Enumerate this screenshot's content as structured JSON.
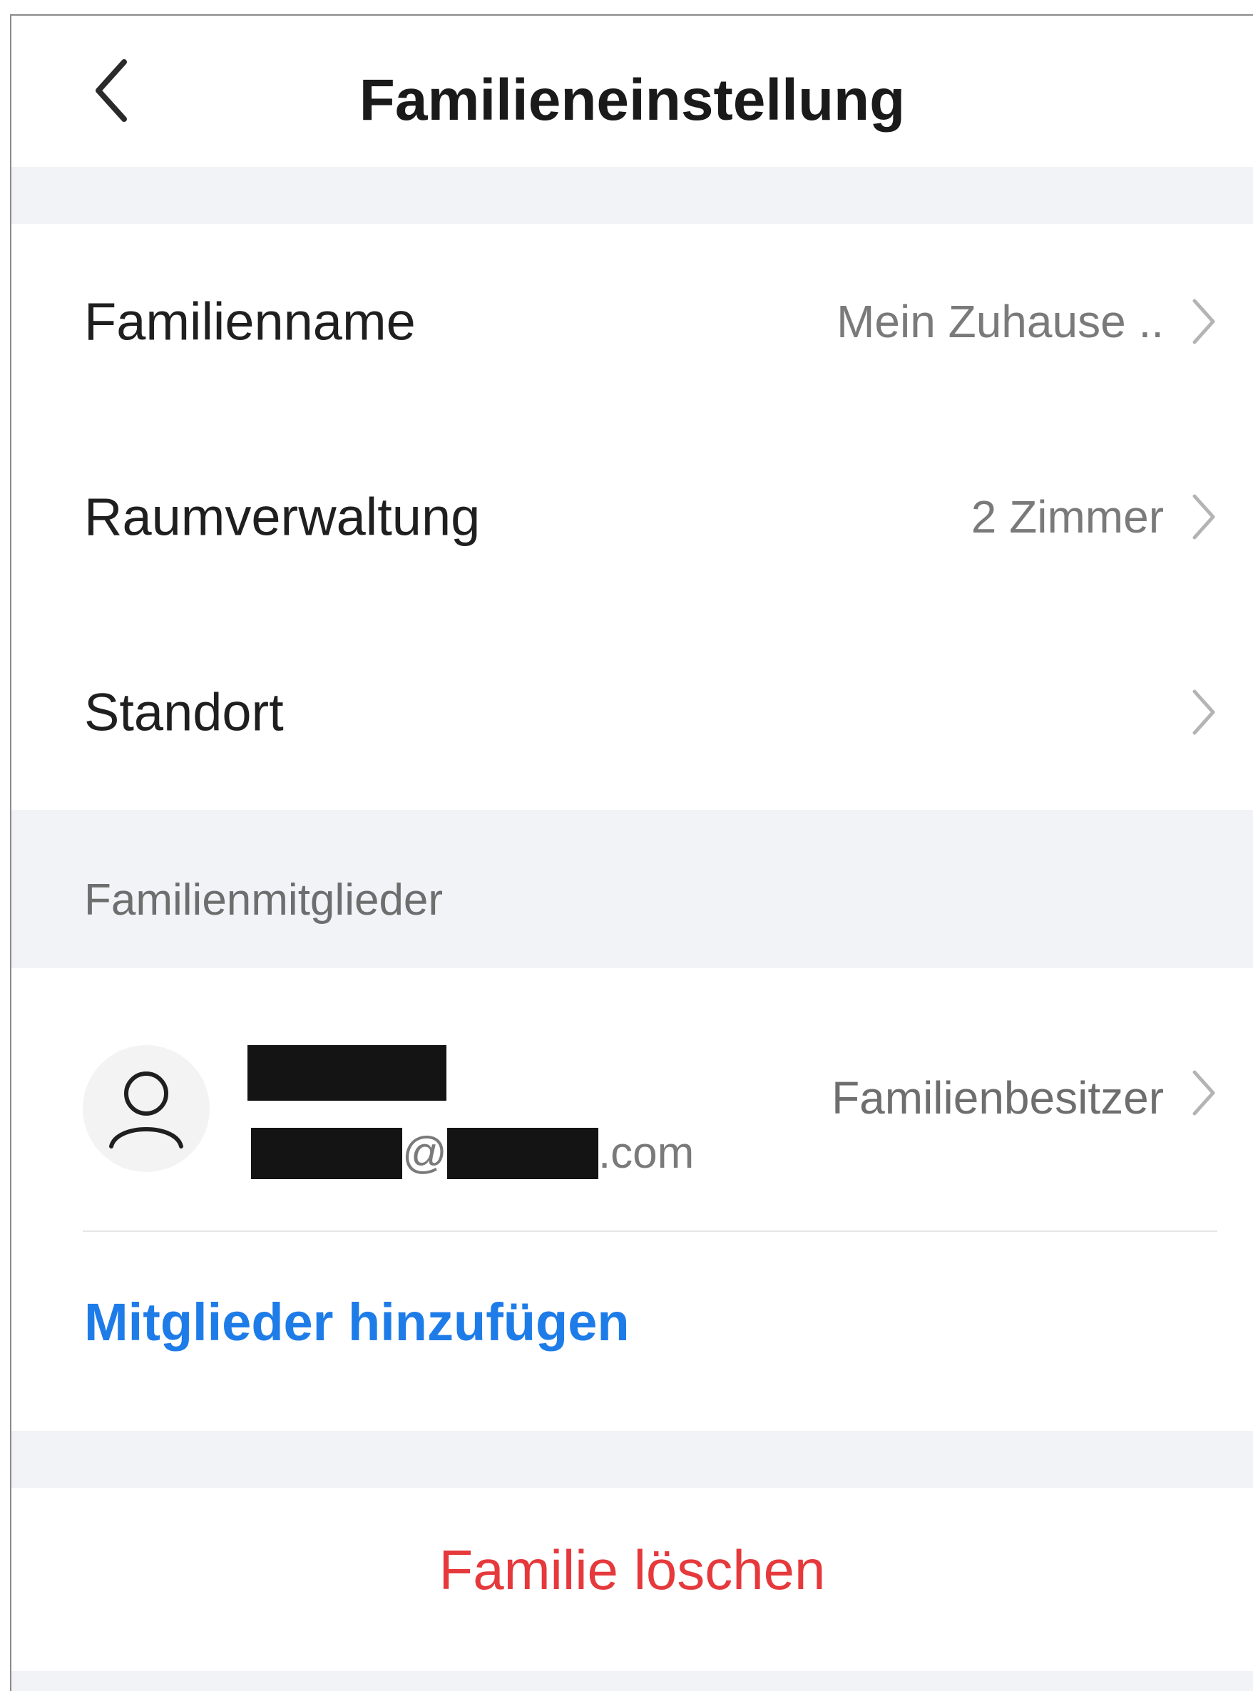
{
  "header": {
    "title": "Familieneinstellung",
    "back_icon": "chevron-left-icon"
  },
  "settings": [
    {
      "label": "Familienname",
      "value": "Mein Zuhause .."
    },
    {
      "label": "Raumverwaltung",
      "value": "2 Zimmer"
    },
    {
      "label": "Standort",
      "value": ""
    }
  ],
  "members_section": {
    "label": "Familienmitglieder",
    "members": [
      {
        "avatar_icon": "user-icon",
        "name": "",
        "email_at": "@",
        "email_suffix": ".com",
        "role": "Familienbesitzer"
      }
    ],
    "add_label": "Mitglieder hinzufügen"
  },
  "delete_label": "Familie löschen",
  "colors": {
    "background": "#ffffff",
    "section_gap": "#f2f3f7",
    "accent_blue": "#1e7ce8",
    "danger_red": "#e5393c",
    "secondary_text": "#7a7a7a"
  }
}
